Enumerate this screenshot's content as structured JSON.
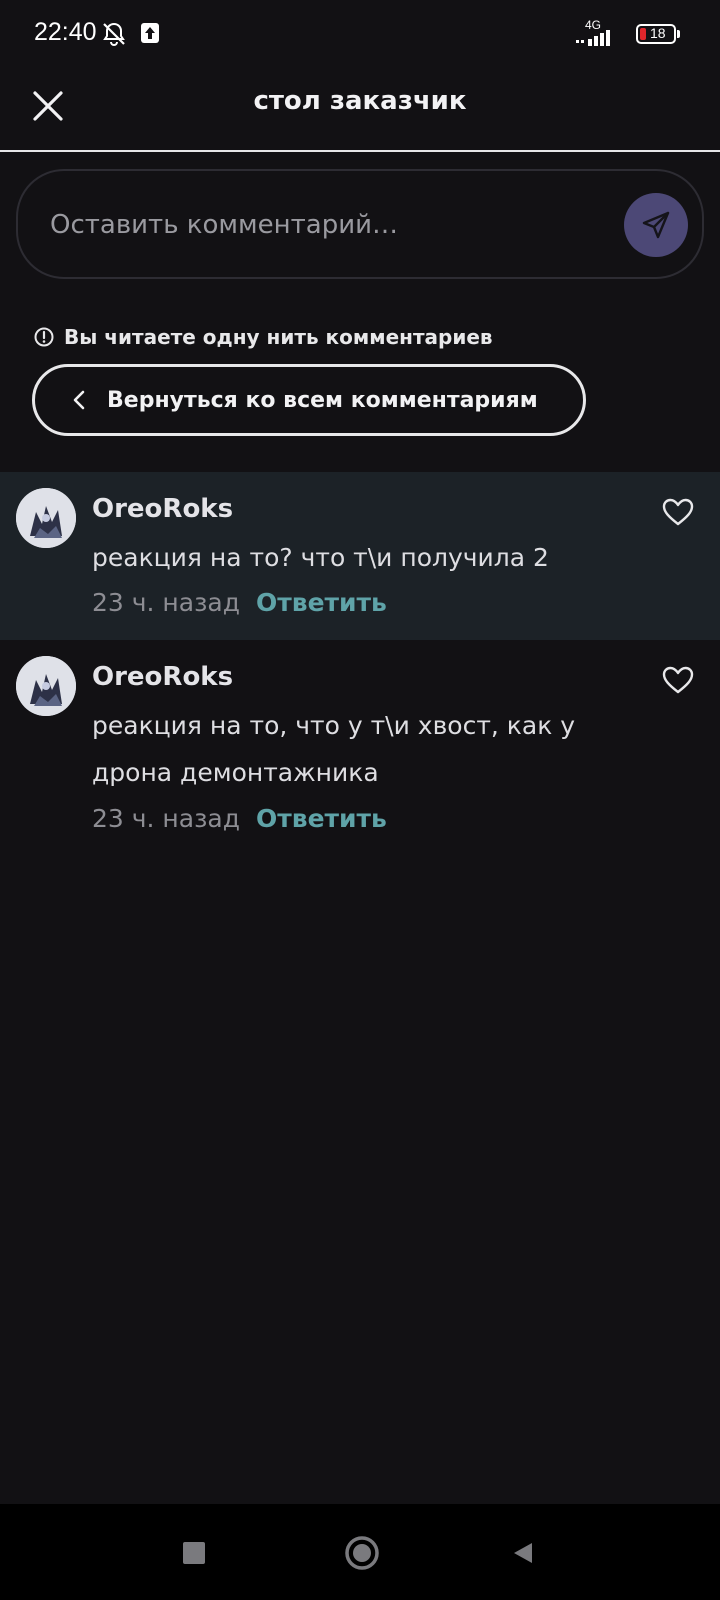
{
  "status_bar": {
    "time": "22:40",
    "network": "4G",
    "battery": "18"
  },
  "header": {
    "title": "стол заказчик"
  },
  "comment_input": {
    "placeholder": "Оставить комментарий…"
  },
  "thread": {
    "notice": "Вы читаете одну нить комментариев",
    "back_label": "Вернуться ко всем комментариям"
  },
  "comments": [
    {
      "author": "OreoRoks",
      "text": "реакция на то? что т\\и получила 2",
      "time": "23 ч. назад",
      "reply": "Ответить"
    },
    {
      "author": "OreoRoks",
      "text": "реакция на то, что у т\\и хвост, как у дрона демонтажника",
      "time": "23 ч. назад",
      "reply": "Ответить"
    }
  ],
  "colors": {
    "background": "#121114",
    "highlight_row": "#1c2227",
    "send_button": "#4c4876",
    "reply_link": "#5fa3a8"
  },
  "icons": {
    "close": "close-icon",
    "send": "send-icon",
    "info": "info-icon",
    "back": "chevron-left-icon",
    "like": "heart-icon"
  }
}
